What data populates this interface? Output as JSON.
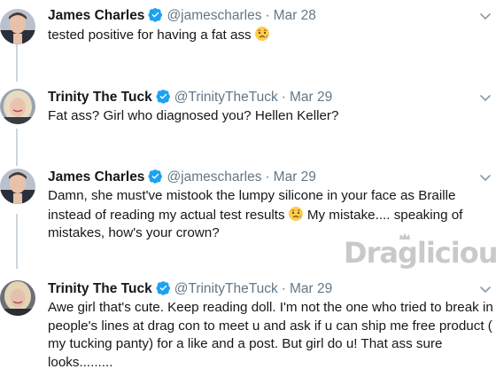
{
  "tweets": [
    {
      "name": "James Charles",
      "handle": "@jamescharles",
      "separator": "·",
      "date": "Mar 28",
      "text": "tested positive for having a fat ass",
      "emoji": "worried-face"
    },
    {
      "name": "Trinity The Tuck",
      "handle": "@TrinityTheTuck",
      "separator": "·",
      "date": "Mar 29",
      "text": "Fat ass? Girl who diagnosed you? Hellen Keller?"
    },
    {
      "name": "James Charles",
      "handle": "@jamescharles",
      "separator": "·",
      "date": "Mar 29",
      "text_part1": "Damn, she must've mistook the lumpy silicone in your face as Braille instead of reading my actual test results",
      "text_part2": " My mistake.... speaking of mistakes, how's your crown?",
      "emoji": "worried-face"
    },
    {
      "name": "Trinity The Tuck",
      "handle": "@TrinityTheTuck",
      "separator": "·",
      "date": "Mar 29",
      "text": "Awe girl that's cute. Keep reading doll. I'm not the one who tried to break in people's lines at drag con to meet u and ask if u can ship me free product ( my tucking panty) for a like and a post. But girl do u! That ass sure looks........."
    }
  ],
  "watermark": {
    "text": "Draglicious",
    "color": "#c9c9c9"
  },
  "colors": {
    "verified": "#1da1f2",
    "secondary_text": "#657786",
    "thread_line": "#ccd6dd"
  }
}
